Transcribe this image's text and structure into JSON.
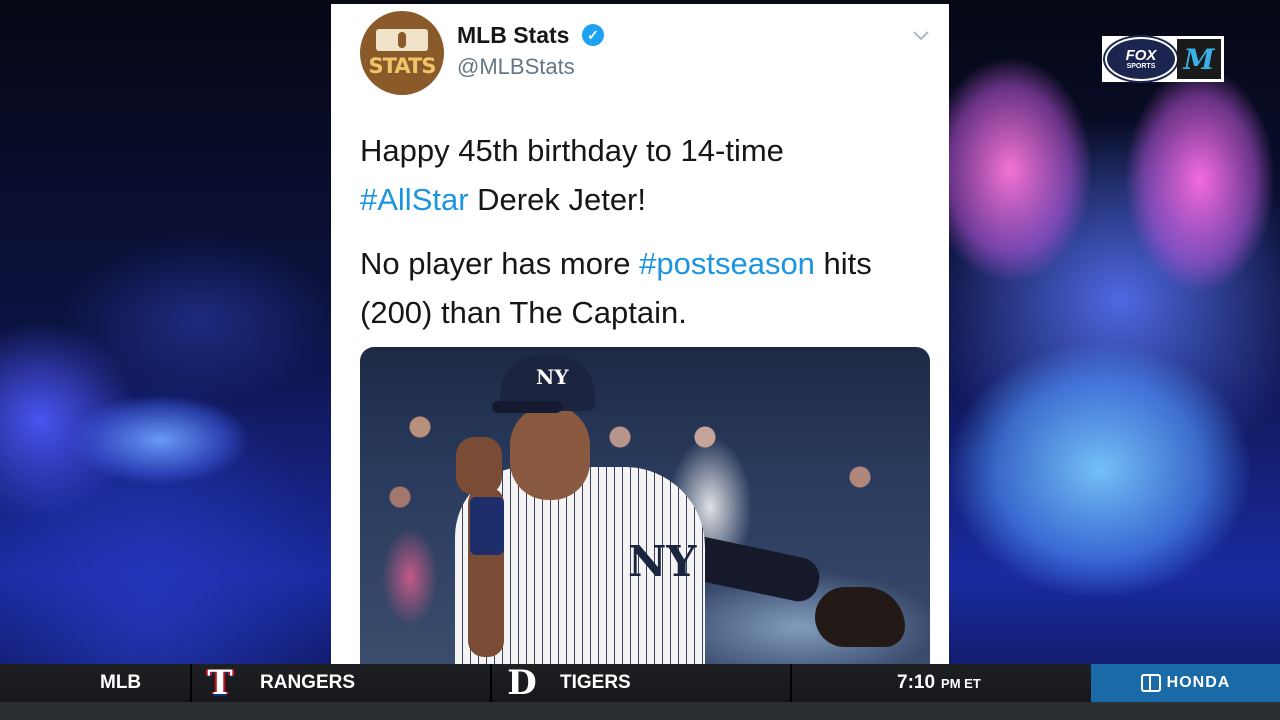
{
  "tweet": {
    "display_name": "MLB Stats",
    "handle": "@MLBStats",
    "avatar_text": "STATS",
    "line1": "Happy 45th birthday to 14-time",
    "hashtag1": "#AllStar",
    "line2_rest": " Derek Jeter!",
    "line3_pre": "No player has more ",
    "hashtag2": "#postseason",
    "line3_post": " hits",
    "line4": "(200) than The Captain.",
    "cap_logo": "NY",
    "jersey_logo": "NY"
  },
  "network_bug": {
    "fox_line1": "FOX",
    "fox_line2": "SPORTS",
    "team_logo": "M"
  },
  "ticker": {
    "league": "MLB",
    "team1_logo": "T",
    "team1": "RANGERS",
    "team2_logo": "D",
    "team2": "TIGERS",
    "time": "7:10",
    "timezone": "PM ET",
    "sponsor": "HONDA"
  }
}
